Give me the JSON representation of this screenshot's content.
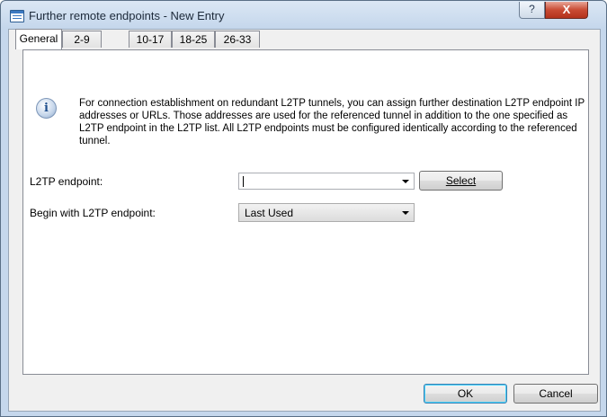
{
  "window": {
    "title": "Further remote endpoints - New Entry",
    "help_label": "?",
    "close_label": "X"
  },
  "tabs": [
    {
      "label": "General",
      "active": true
    },
    {
      "label": "2-9",
      "active": false
    },
    {
      "label": "10-17",
      "active": false
    },
    {
      "label": "18-25",
      "active": false
    },
    {
      "label": "26-33",
      "active": false
    }
  ],
  "info": {
    "icon": "info-icon",
    "glyph": "i",
    "text": "For connection establishment on redundant L2TP tunnels, you can assign further destination L2TP endpoint IP addresses or URLs. Those addresses are used for the referenced tunnel in addition to the one specified as L2TP endpoint in the L2TP list. All L2TP endpoints must be configured identically according to the referenced tunnel."
  },
  "form": {
    "endpoint_label": "L2TP endpoint:",
    "endpoint_value": "",
    "select_button": "Select",
    "begin_label": "Begin with L2TP endpoint:",
    "begin_value": "Last Used"
  },
  "buttons": {
    "ok": "OK",
    "cancel": "Cancel"
  },
  "colors": {
    "title_bar": "#c5d7ec",
    "close_button": "#c94b34",
    "default_button_border": "#3c7fb1"
  }
}
